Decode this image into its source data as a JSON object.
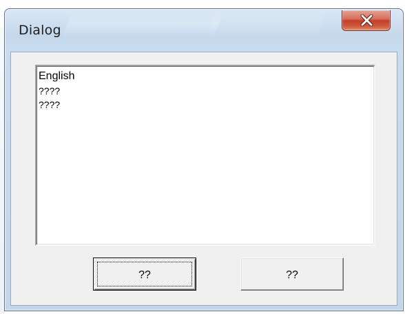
{
  "window": {
    "title": "Dialog"
  },
  "title_bar": {
    "close_icon": "close-x-icon",
    "close_color": "#c7432b"
  },
  "listbox": {
    "items": [
      {
        "label": "English"
      },
      {
        "label": "????"
      },
      {
        "label": "????"
      }
    ]
  },
  "buttons": {
    "default_label": "??",
    "secondary_label": "??"
  },
  "colors": {
    "frame": "#c9dbee",
    "client": "#f0f0f0",
    "close_button": "#c7432b"
  }
}
